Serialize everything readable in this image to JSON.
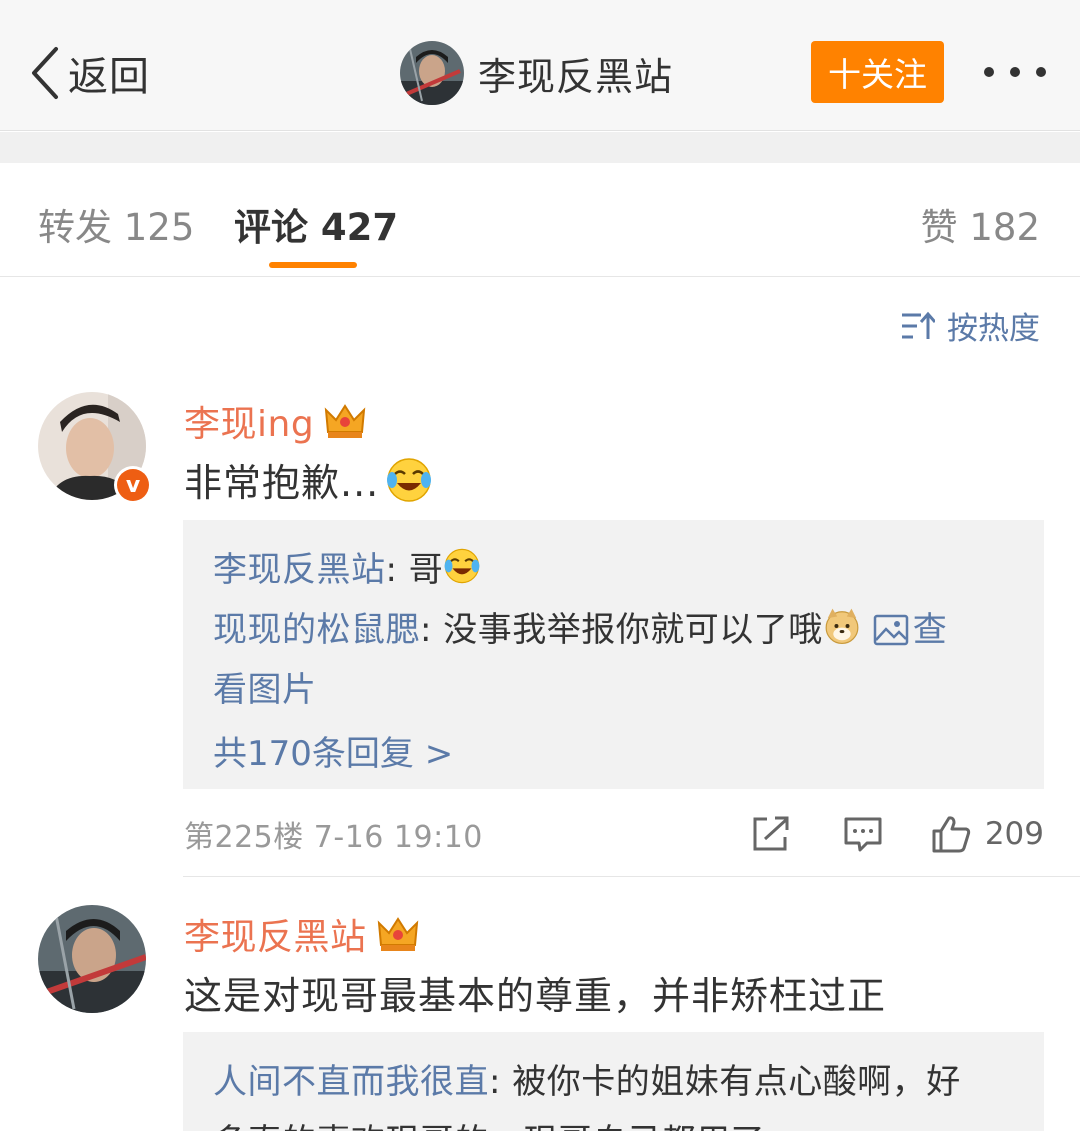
{
  "navbar": {
    "back_label": "返回",
    "title": "李现反黑站",
    "follow_label": "十关注",
    "accent": "#ff8200"
  },
  "tabs": {
    "repost": "转发 125",
    "comment": "评论 427",
    "like": "赞 182"
  },
  "sort": {
    "label": "按热度",
    "icon": "sort-icon"
  },
  "comments": [
    {
      "user": "李现ing",
      "verified": true,
      "badge": "crown-badge",
      "text": "非常抱歉...",
      "emoji": "laugh-cry-emoji",
      "replies": [
        {
          "user": "李现反黑站",
          "sep": ": ",
          "text": "哥",
          "emoji": "laugh-cry-emoji"
        },
        {
          "user": "现现的松鼠腮",
          "sep": ": ",
          "text": "没事我举报你就可以了哦",
          "emoji": "doge-emoji",
          "link_a": "查",
          "link_b": "看图片"
        }
      ],
      "total_replies": "共170条回复 >",
      "floor": "第225楼 7-16 19:10",
      "likes": "209"
    },
    {
      "user": "李现反黑站",
      "badge": "crown-badge",
      "text": "这是对现哥最基本的尊重，并非矫枉过正",
      "replies": [
        {
          "user": "人间不直而我很直",
          "sep": ": ",
          "text": "被你卡的姐妹有点心酸啊，好",
          "text2": "多真的喜欢现哥的，现哥自己都用了"
        }
      ]
    }
  ],
  "colors": {
    "username": "#eb7350",
    "link": "#5b7aa8",
    "reply_bg": "#f2f2f2"
  }
}
